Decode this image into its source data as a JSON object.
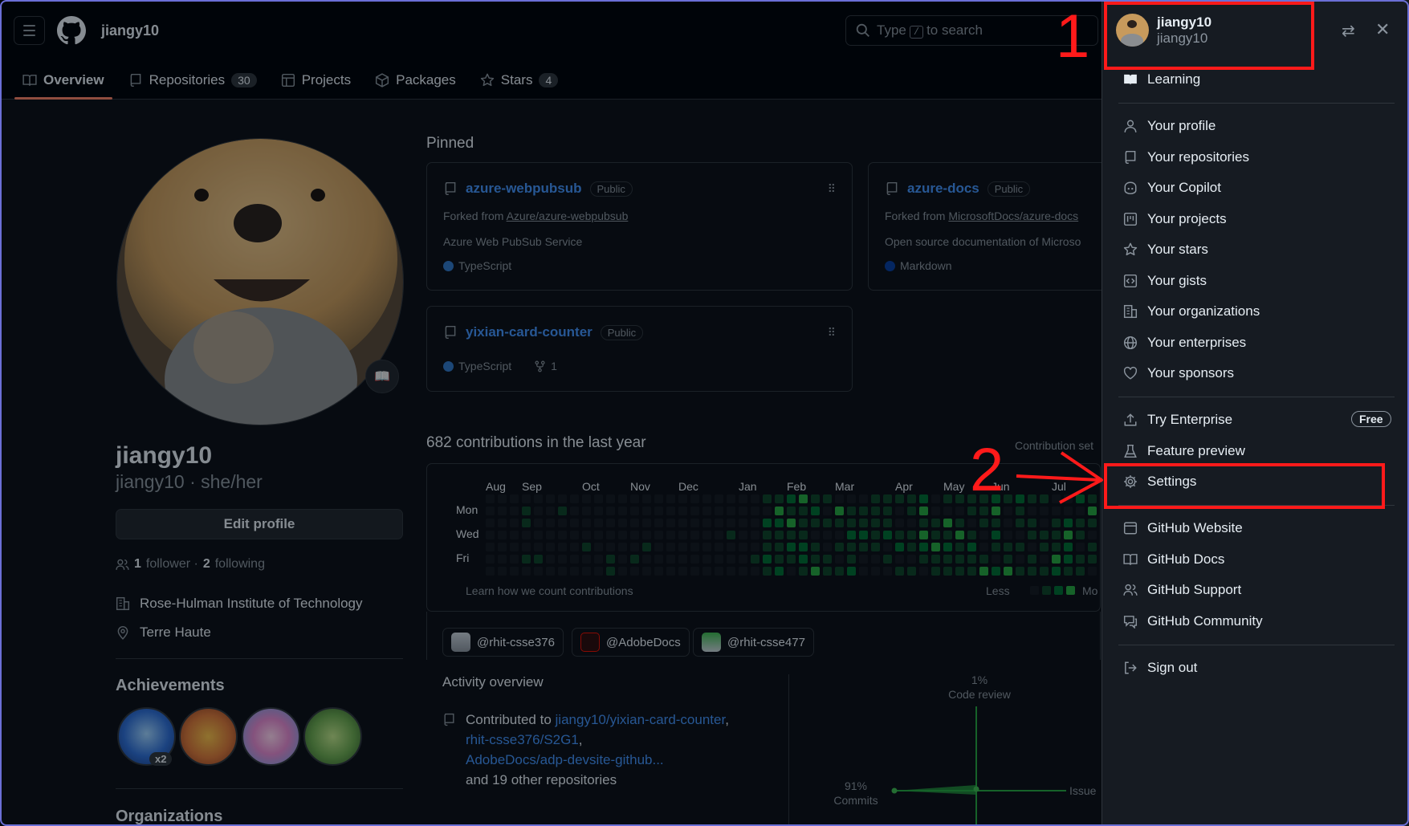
{
  "header": {
    "username": "jiangy10",
    "search_prefix": "Type",
    "search_key": "/",
    "search_suffix": "to search"
  },
  "tabs": [
    {
      "label": "Overview",
      "count": null
    },
    {
      "label": "Repositories",
      "count": "30"
    },
    {
      "label": "Projects",
      "count": null
    },
    {
      "label": "Packages",
      "count": null
    },
    {
      "label": "Stars",
      "count": "4"
    }
  ],
  "profile": {
    "name": "jiangy10",
    "subtitle": "jiangy10 · she/her",
    "edit_label": "Edit profile",
    "followers_count": "1",
    "followers_label": "follower ·",
    "following_count": "2",
    "following_label": "following",
    "org": "Rose-Hulman Institute of Technology",
    "location": "Terre Haute",
    "achievements_title": "Achievements",
    "achievement_multiplier": "x2",
    "organizations_title": "Organizations"
  },
  "pinned": {
    "title": "Pinned",
    "cards": [
      {
        "name": "azure-webpubsub",
        "visibility": "Public",
        "fork_prefix": "Forked from",
        "fork_source": "Azure/azure-webpubsub",
        "description": "Azure Web PubSub Service",
        "language": "TypeScript"
      },
      {
        "name": "azure-docs",
        "visibility": "Public",
        "fork_prefix": "Forked from",
        "fork_source": "MicrosoftDocs/azure-docs",
        "description": "Open source documentation of Microso",
        "language": "Markdown"
      },
      {
        "name": "yixian-card-counter",
        "visibility": "Public",
        "language": "TypeScript",
        "forks": "1"
      }
    ]
  },
  "contributions": {
    "title": "682 contributions in the last year",
    "settings_label": "Contribution set",
    "months": [
      "Aug",
      "Sep",
      "Oct",
      "Nov",
      "Dec",
      "Jan",
      "Feb",
      "Mar",
      "Apr",
      "May",
      "Jun",
      "Jul"
    ],
    "days": [
      "Mon",
      "Wed",
      "Fri"
    ],
    "learn_label": "Learn how we count contributions",
    "less_label": "Less",
    "more_label": "Mo"
  },
  "orgs": [
    "@rhit-csse376",
    "@AdobeDocs",
    "@rhit-csse477"
  ],
  "activity": {
    "title": "Activity overview",
    "contributed_prefix": "Contributed to",
    "repo1": "jiangy10/yixian-card-counter",
    "repo2": "rhit-csse376/S2G1",
    "repo3": "AdobeDocs/adp-devsite-github...",
    "other": "and 19 other repositories",
    "code_review_pct": "1%",
    "code_review_label": "Code review",
    "commits_pct": "91%",
    "commits_label": "Commits",
    "issues_label": "Issue"
  },
  "drawer": {
    "name": "jiangy10",
    "login": "jiangy10",
    "items": [
      {
        "label": "Learning",
        "icon": "book-icon"
      },
      {
        "label": "Your profile",
        "icon": "person-icon"
      },
      {
        "label": "Your repositories",
        "icon": "repo-icon"
      },
      {
        "label": "Your Copilot",
        "icon": "copilot-icon"
      },
      {
        "label": "Your projects",
        "icon": "project-icon"
      },
      {
        "label": "Your stars",
        "icon": "star-icon"
      },
      {
        "label": "Your gists",
        "icon": "code-square-icon"
      },
      {
        "label": "Your organizations",
        "icon": "organization-icon"
      },
      {
        "label": "Your enterprises",
        "icon": "globe-icon"
      },
      {
        "label": "Your sponsors",
        "icon": "heart-icon"
      },
      {
        "label": "Try Enterprise",
        "icon": "upload-icon"
      },
      {
        "label": "Feature preview",
        "icon": "beaker-icon"
      },
      {
        "label": "Settings",
        "icon": "gear-icon"
      },
      {
        "label": "GitHub Website",
        "icon": "browser-icon"
      },
      {
        "label": "GitHub Docs",
        "icon": "book-open-icon"
      },
      {
        "label": "GitHub Support",
        "icon": "people-icon"
      },
      {
        "label": "GitHub Community",
        "icon": "comment-icon"
      },
      {
        "label": "Sign out",
        "icon": "sign-out-icon"
      }
    ],
    "free_badge": "Free"
  },
  "annotations": {
    "step1": "1",
    "step2": "2",
    "color": "#ff1a1a"
  }
}
